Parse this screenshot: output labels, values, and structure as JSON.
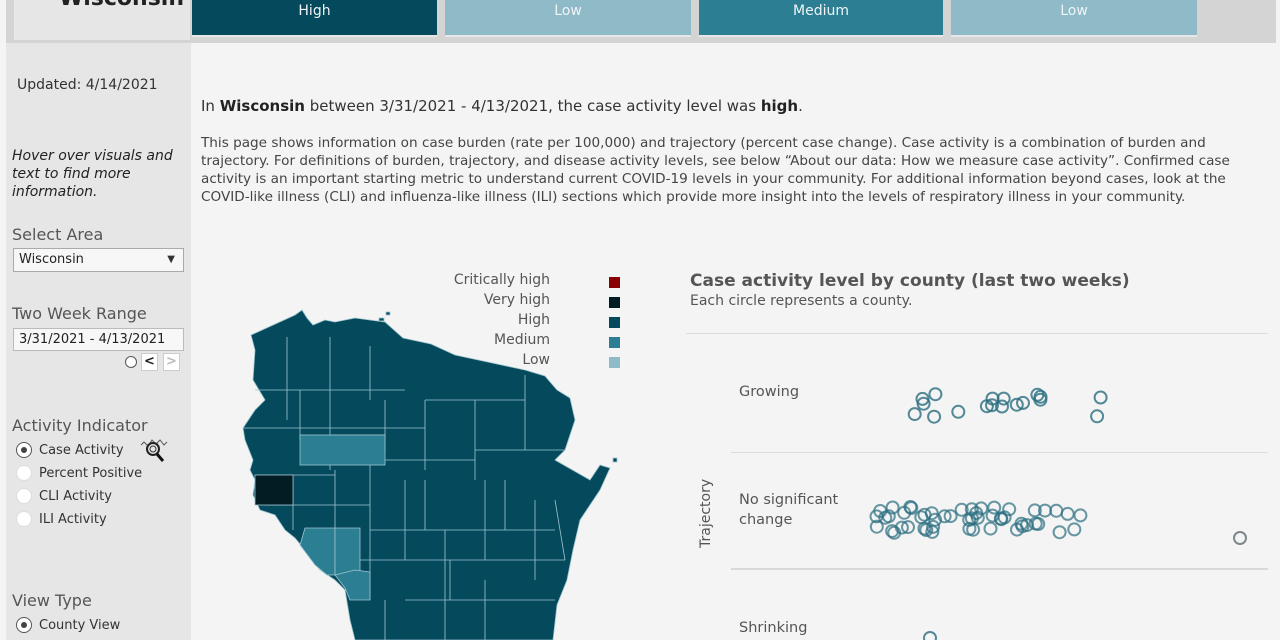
{
  "header": {
    "title": "Wisconsin",
    "tiles": [
      {
        "label": "High",
        "color": "#054a5c"
      },
      {
        "label": "Low",
        "color": "#8fbac7"
      },
      {
        "label": "Medium",
        "color": "#2c7f93"
      },
      {
        "label": "Low",
        "color": "#8fbac7"
      }
    ]
  },
  "sidebar": {
    "updated": "Updated: 4/14/2021",
    "hover_note": "Hover over visuals and text to find more information.",
    "select_area_label": "Select Area",
    "select_area_value": "Wisconsin",
    "two_week_label": "Two Week Range",
    "two_week_value": "3/31/2021 - 4/13/2021",
    "prev_label": "<",
    "next_label": ">",
    "activity_label": "Activity Indicator",
    "activity_options": [
      {
        "label": "Case Activity",
        "selected": true
      },
      {
        "label": "Percent Positive",
        "selected": false
      },
      {
        "label": "CLI Activity",
        "selected": false
      },
      {
        "label": "ILI Activity",
        "selected": false
      }
    ],
    "view_type_label": "View Type",
    "view_type_options": [
      {
        "label": "County View",
        "selected": true
      }
    ]
  },
  "main": {
    "headline_pre": "In ",
    "headline_area": "Wisconsin",
    "headline_mid": " between 3/31/2021 - 4/13/2021, the case activity level was ",
    "headline_level": "high",
    "headline_end": ".",
    "description": "This page shows information on case burden (rate per 100,000) and trajectory (percent case change). Case activity is a combination of burden and trajectory. For definitions of burden, trajectory, and disease activity levels, see below “About our data: How we measure case activity”. Confirmed case activity is an important starting metric to understand current COVID-19 levels in your community. For additional information beyond cases, look at the COVID-like illness (CLI) and influenza-like illness (ILI) sections which provide more insight into the levels of respiratory illness in your community."
  },
  "legend": [
    {
      "label": "Critically high",
      "color": "#8b0000"
    },
    {
      "label": "Very high",
      "color": "#021c24"
    },
    {
      "label": "High",
      "color": "#054a5c"
    },
    {
      "label": "Medium",
      "color": "#2c7f93"
    },
    {
      "label": "Low",
      "color": "#8fbac7"
    }
  ],
  "chart": {
    "title": "Case activity level by county (last two weeks)",
    "subtitle": "Each circle represents a county.",
    "y_axis_label": "Trajectory",
    "rows": [
      {
        "label": "Growing",
        "count": 18
      },
      {
        "label": "No significant change",
        "line1": "No significant",
        "line2": "change",
        "count": 53
      },
      {
        "label": "Shrinking",
        "count": 1
      }
    ]
  }
}
